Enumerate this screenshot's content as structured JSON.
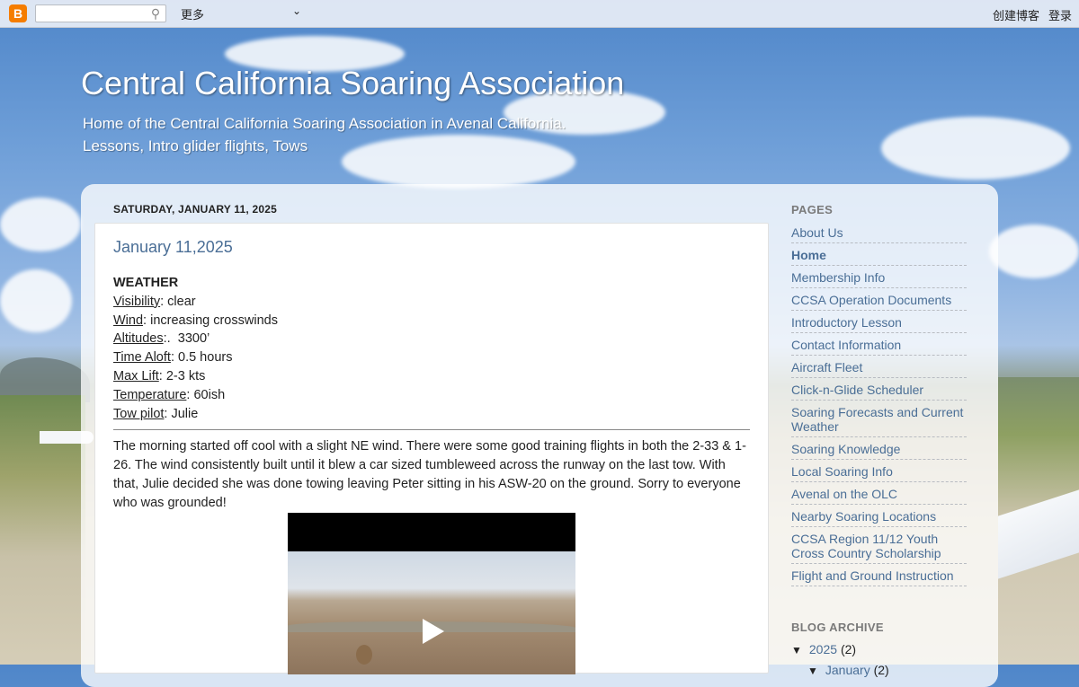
{
  "navbar": {
    "logo": "B",
    "more": "更多",
    "create_blog": "创建博客",
    "login": "登录"
  },
  "header": {
    "title": "Central California Soaring Association",
    "description_line1": "Home of the Central California Soaring Association in Avenal California.",
    "description_line2": "Lessons, Intro glider flights, Tows"
  },
  "post": {
    "date": "SATURDAY, JANUARY 11, 2025",
    "title": "January 11,2025",
    "weather_heading": "WEATHER",
    "weather": [
      {
        "label": "Visibility",
        "sep": ": ",
        "value": "clear"
      },
      {
        "label": "Wind",
        "sep": ": ",
        "value": "increasing crosswinds"
      },
      {
        "label": "Altitudes",
        "sep": ":.  ",
        "value": "3300’"
      },
      {
        "label": "Time Aloft",
        "sep": ": ",
        "value": "0.5 hours"
      },
      {
        "label": "Max Lift",
        "sep": ": ",
        "value": "2-3 kts"
      },
      {
        "label": "Temperature",
        "sep": ": ",
        "value": "60ish"
      },
      {
        "label": "Tow pilot",
        "sep": ": ",
        "value": "Julie"
      }
    ],
    "body": "The morning started off cool with a slight NE wind. There were some good training flights in both the 2-33 & 1-26. The wind consistently built until it blew a car sized tumbleweed across the runway on the last tow. With that, Julie decided she was done towing leaving Peter sitting in his ASW-20 on the ground. Sorry to everyone who was grounded!"
  },
  "sidebar": {
    "pages_heading": "PAGES",
    "pages": [
      {
        "label": "About Us",
        "active": false
      },
      {
        "label": "Home",
        "active": true
      },
      {
        "label": "Membership Info",
        "active": false
      },
      {
        "label": "CCSA Operation Documents",
        "active": false
      },
      {
        "label": "Introductory Lesson",
        "active": false
      },
      {
        "label": "Contact Information",
        "active": false
      },
      {
        "label": "Aircraft Fleet",
        "active": false
      },
      {
        "label": "Click-n-Glide Scheduler",
        "active": false
      },
      {
        "label": "Soaring Forecasts and Current Weather",
        "active": false
      },
      {
        "label": "Soaring Knowledge",
        "active": false
      },
      {
        "label": "Local Soaring Info",
        "active": false
      },
      {
        "label": "Avenal on the OLC",
        "active": false
      },
      {
        "label": "Nearby Soaring Locations",
        "active": false
      },
      {
        "label": "CCSA Region 11/12 Youth Cross Country Scholarship",
        "active": false
      },
      {
        "label": "Flight and Ground Instruction",
        "active": false
      }
    ],
    "archive_heading": "BLOG ARCHIVE",
    "archive": [
      {
        "arrow": "▼",
        "label": "2025",
        "count": "(2)"
      },
      {
        "arrow": "▼",
        "label": "January",
        "count": "(2)"
      }
    ]
  }
}
